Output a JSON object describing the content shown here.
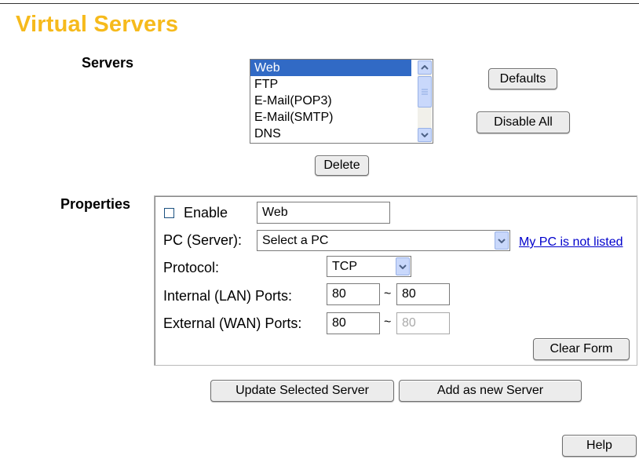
{
  "page": {
    "title": "Virtual Servers"
  },
  "servers": {
    "label": "Servers",
    "list": [
      "Web",
      "FTP",
      "E-Mail(POP3)",
      "E-Mail(SMTP)",
      "DNS"
    ],
    "selected": "Web",
    "defaults_label": "Defaults",
    "disable_all_label": "Disable All",
    "delete_label": "Delete"
  },
  "properties": {
    "label": "Properties",
    "enable_label": "Enable",
    "enabled": false,
    "name_value": "Web",
    "pc_label": "PC (Server):",
    "pc_value": "Select a PC",
    "pc_link": "My PC is not listed",
    "protocol_label": "Protocol:",
    "protocol_value": "TCP",
    "internal_label": "Internal (LAN) Ports:",
    "internal_from": "80",
    "internal_to": "80",
    "external_label": "External (WAN) Ports:",
    "external_from": "80",
    "external_to": "80",
    "range_sep": "~",
    "clear_label": "Clear Form"
  },
  "actions": {
    "update_label": "Update Selected Server",
    "add_label": "Add as new Server",
    "help_label": "Help"
  },
  "icons": {
    "scroll_up": "arrow-up-icon",
    "scroll_down": "arrow-down-icon",
    "dropdown": "chevron-down-icon"
  },
  "colors": {
    "title": "#f6ba1c",
    "selection": "#316ac5",
    "link": "#0000cc"
  }
}
